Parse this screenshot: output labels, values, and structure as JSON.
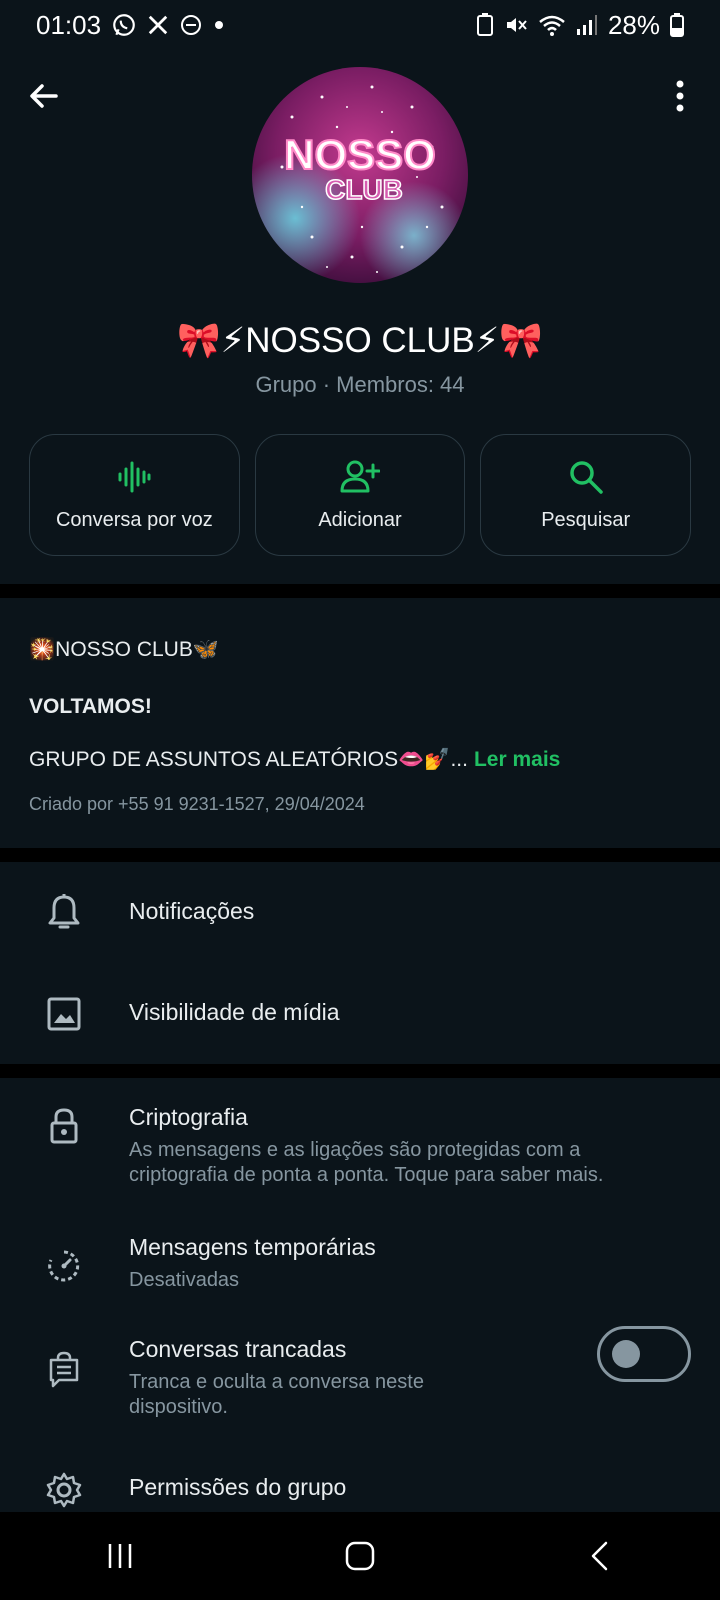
{
  "status_bar": {
    "time": "01:03",
    "battery": "28%",
    "left_icons": [
      "whatsapp-icon",
      "x-icon",
      "dnd-icon",
      "dot-icon"
    ],
    "right_icons": [
      "battery-saver-icon",
      "mute-icon",
      "wifi-icon",
      "signal-icon",
      "battery-icon"
    ]
  },
  "header": {
    "group_name": "🎀⚡NOSSO CLUB⚡🎀",
    "subtitle": "Grupo · Membros: 44",
    "avatar_text": "NOSSO CLUB"
  },
  "actions": [
    {
      "label": "Conversa por voz",
      "icon": "voice-waveform-icon"
    },
    {
      "label": "Adicionar",
      "icon": "add-person-icon"
    },
    {
      "label": "Pesquisar",
      "icon": "search-icon"
    }
  ],
  "description": {
    "line1": "🎇NOSSO CLUB🦋",
    "line2": "VOLTAMOS!",
    "line3": "GRUPO DE ASSUNTOS ALEATÓRIOS👄💅...",
    "read_more": "Ler mais",
    "created_by": "Criado por +55 91 9231-1527, 29/04/2024"
  },
  "settings_group1": [
    {
      "title": "Notificações",
      "icon": "bell-icon"
    },
    {
      "title": "Visibilidade de mídia",
      "icon": "image-icon"
    }
  ],
  "settings_group2": [
    {
      "title": "Criptografia",
      "subtitle": "As mensagens e as ligações são protegidas com a criptografia de ponta a ponta. Toque para saber mais.",
      "icon": "lock-icon"
    },
    {
      "title": "Mensagens temporárias",
      "subtitle": "Desativadas",
      "icon": "timer-icon"
    },
    {
      "title": "Conversas trancadas",
      "subtitle": "Tranca e oculta a conversa neste dispositivo.",
      "icon": "locked-chat-icon",
      "toggle": false
    },
    {
      "title": "Permissões do grupo",
      "icon": "gear-icon"
    }
  ],
  "colors": {
    "accent": "#21c063",
    "background": "#0b141a",
    "divider": "#000000",
    "secondary_text": "#8696a0"
  }
}
